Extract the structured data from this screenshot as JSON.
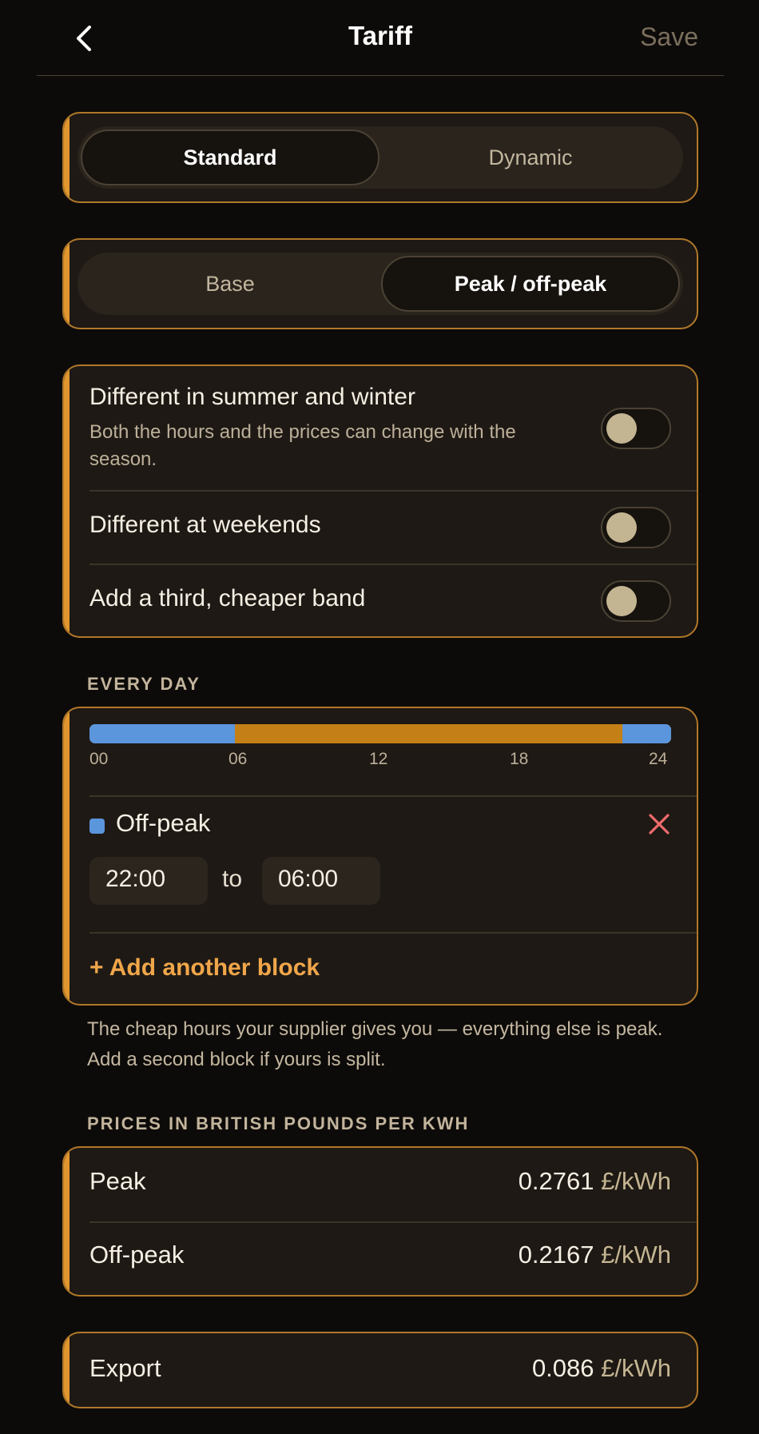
{
  "header": {
    "title": "Tariff",
    "save_label": "Save"
  },
  "tariff_type": {
    "options": [
      "Standard",
      "Dynamic"
    ],
    "selected": "Standard"
  },
  "tariff_mode": {
    "options": [
      "Base",
      "Peak / off-peak"
    ],
    "selected": "Peak / off-peak"
  },
  "settings": {
    "seasonal": {
      "title": "Different in summer and winter",
      "subtitle": "Both the hours and the prices can change with the season.",
      "enabled": false
    },
    "weekends": {
      "title": "Different at weekends",
      "enabled": false
    },
    "third_band": {
      "title": "Add a third, cheaper band",
      "enabled": false
    }
  },
  "schedule": {
    "section_label": "EVERY DAY",
    "ticks": [
      "00",
      "06",
      "12",
      "18",
      "24"
    ],
    "colors": {
      "off_peak": "#5b95dc",
      "peak": "#c47f16"
    },
    "band": {
      "name": "Off-peak",
      "from": "22:00",
      "to_label": "to",
      "to": "06:00"
    },
    "add_block_label": "+  Add another block",
    "helper": "The cheap hours your supplier gives you — everything else is peak. Add a second block if yours is split."
  },
  "prices": {
    "section_label": "PRICES IN BRITISH POUNDS PER KWH",
    "rows": [
      {
        "label": "Peak",
        "value": "0.2761",
        "unit": "£/kWh"
      },
      {
        "label": "Off-peak",
        "value": "0.2167",
        "unit": "£/kWh"
      }
    ]
  },
  "export": {
    "label": "Export",
    "value": "0.086",
    "unit": "£/kWh"
  },
  "accent_color": "#e0962e"
}
